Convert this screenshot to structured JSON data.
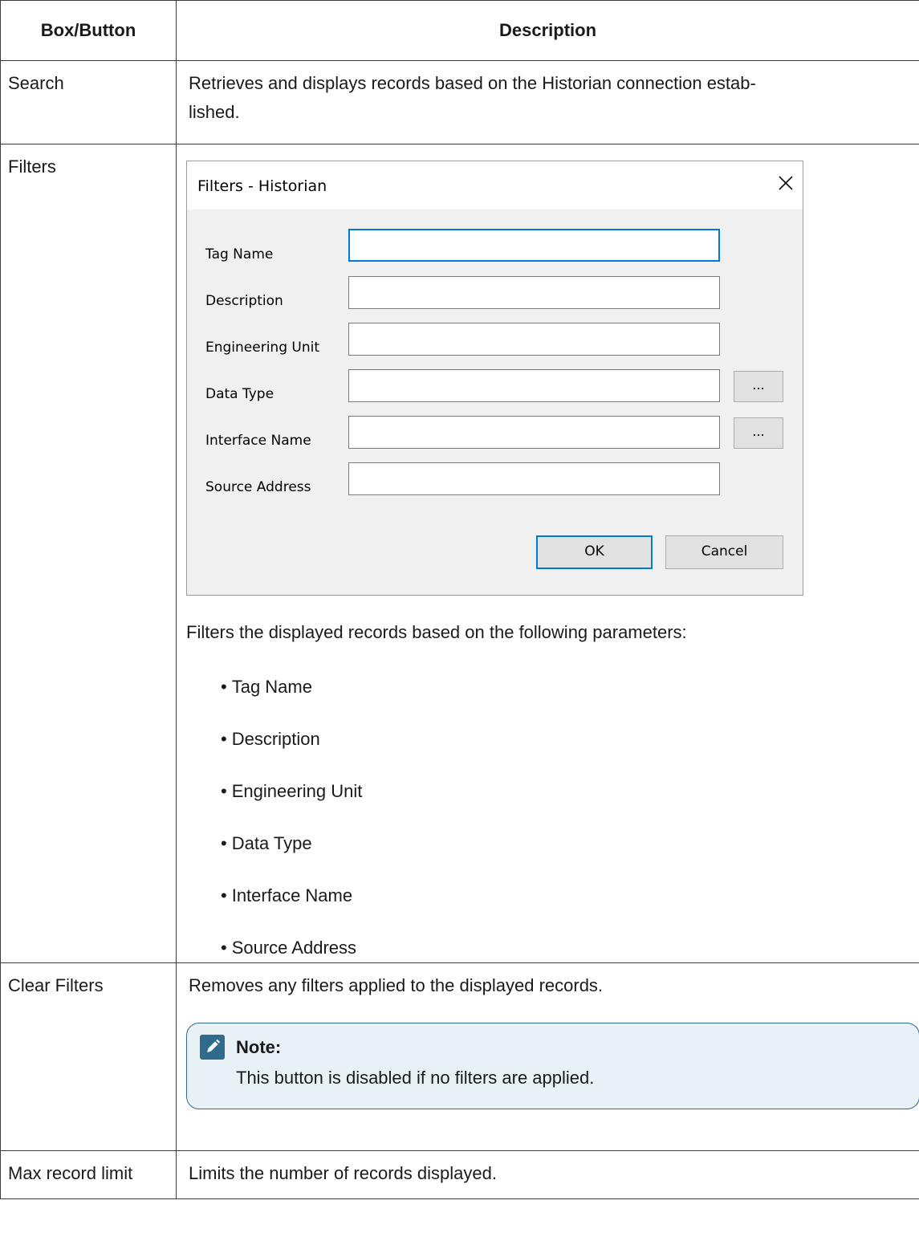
{
  "table": {
    "headers": [
      "Box/Button",
      "Description"
    ],
    "rows": [
      {
        "name": "Search",
        "description": "Retrieves and displays records based on the Historian connection estab-lished."
      },
      {
        "name": "Filters",
        "description": "Filters the displayed records based on the following parameters:"
      },
      {
        "name": "Clear Filters",
        "description": "Removes any filters applied to the displayed records."
      },
      {
        "name": "Max record limit",
        "description": "Limits the number of records displayed."
      }
    ]
  },
  "search_desc": {
    "line1": "Retrieves and displays records based on the Historian connection estab-",
    "line2": "lished."
  },
  "filters_dialog": {
    "title": "Filters - Historian",
    "fields": [
      {
        "label": "Tag Name",
        "value": "",
        "has_browse": false
      },
      {
        "label": "Description",
        "value": "",
        "has_browse": false
      },
      {
        "label": "Engineering Unit",
        "value": "",
        "has_browse": false
      },
      {
        "label": "Data Type",
        "value": "",
        "has_browse": true
      },
      {
        "label": "Interface Name",
        "value": "",
        "has_browse": true
      },
      {
        "label": "Source Address",
        "value": "",
        "has_browse": false
      }
    ],
    "browse_label": "...",
    "ok_label": "OK",
    "cancel_label": "Cancel",
    "accent_color": "#0078d7",
    "close_icon": "close-icon"
  },
  "filter_params": [
    "Tag Name",
    "Description",
    "Engineering Unit",
    "Data Type",
    "Interface Name",
    "Source Address"
  ],
  "note": {
    "title": "Note:",
    "text": "This button is disabled if no filters are applied.",
    "icon": "pencil-icon",
    "border_color": "#2f6b8c",
    "background_color": "#e8f1f5"
  }
}
